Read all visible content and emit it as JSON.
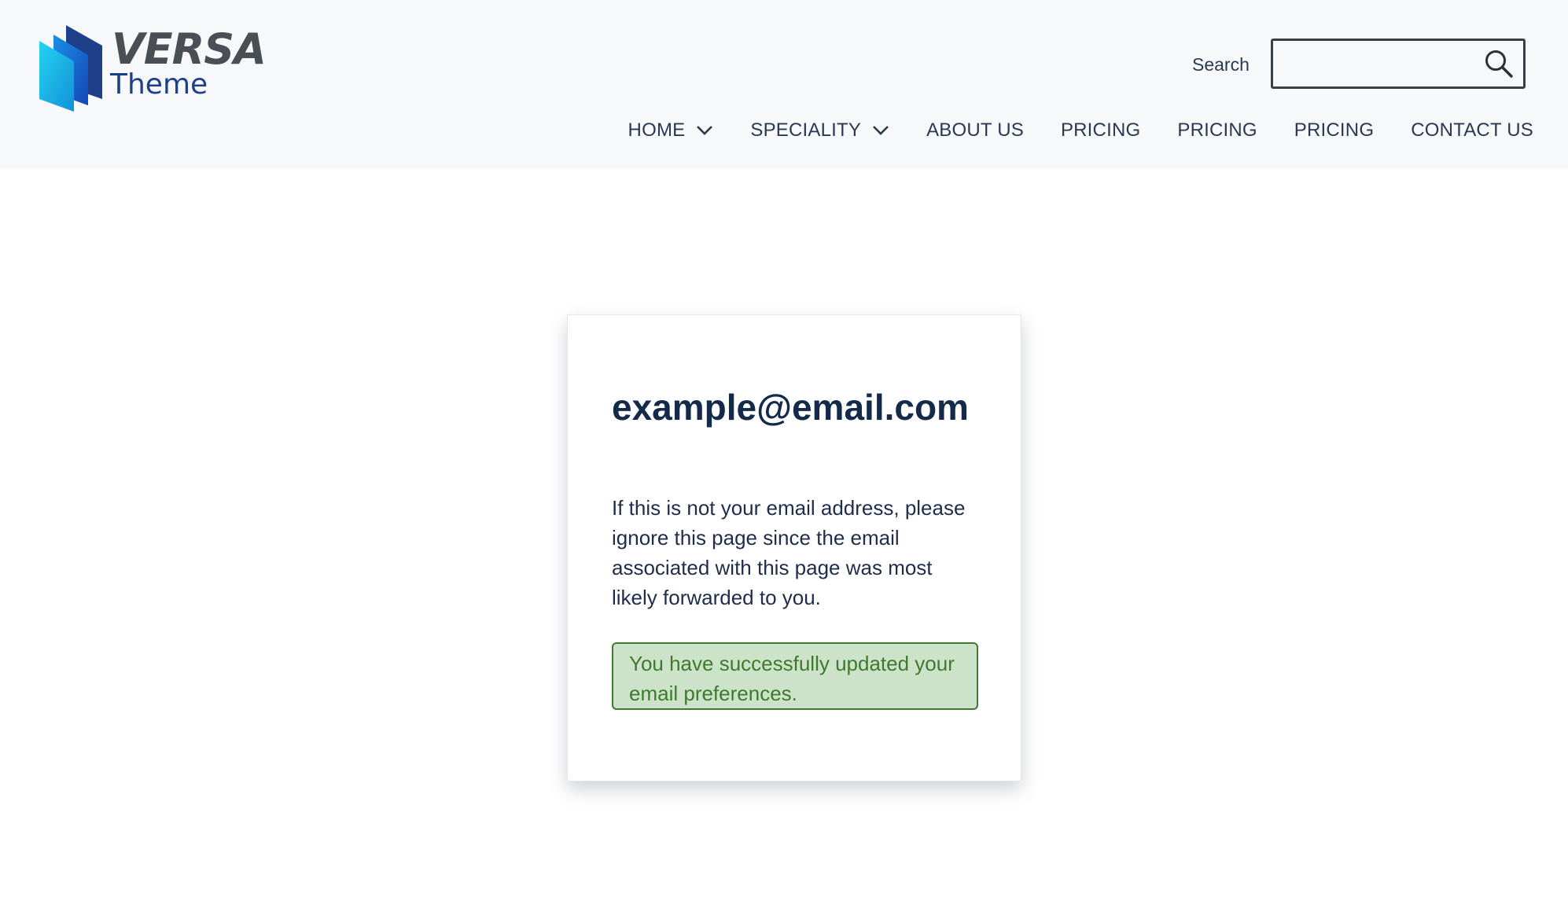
{
  "header": {
    "logo": {
      "brand": "VERSA",
      "tagline": "Theme",
      "icon": "stacked-panels-logo-icon"
    },
    "search": {
      "label": "Search",
      "value": "",
      "placeholder": "",
      "button_icon": "search-icon"
    },
    "nav": {
      "items": [
        {
          "label": "HOME",
          "has_dropdown": true
        },
        {
          "label": "SPECIALITY",
          "has_dropdown": true
        },
        {
          "label": "ABOUT US",
          "has_dropdown": false
        },
        {
          "label": "PRICING",
          "has_dropdown": false
        },
        {
          "label": "PRICING",
          "has_dropdown": false
        },
        {
          "label": "PRICING",
          "has_dropdown": false
        },
        {
          "label": "CONTACT US",
          "has_dropdown": false
        }
      ]
    }
  },
  "card": {
    "email": "example@email.com",
    "note": "If this is not your email address, please ignore this page since the email associated with this page was most likely forwarded to you.",
    "success_message": "You have successfully updated your email preferences."
  },
  "colors": {
    "header_bg": "#f7f8fa",
    "text_primary": "#142a4a",
    "success_bg": "#cde3c9",
    "success_border": "#3f7a31",
    "success_text": "#3d7a2e",
    "logo_blue_dark": "#1e3f8a",
    "logo_cyan": "#17c3e6"
  }
}
